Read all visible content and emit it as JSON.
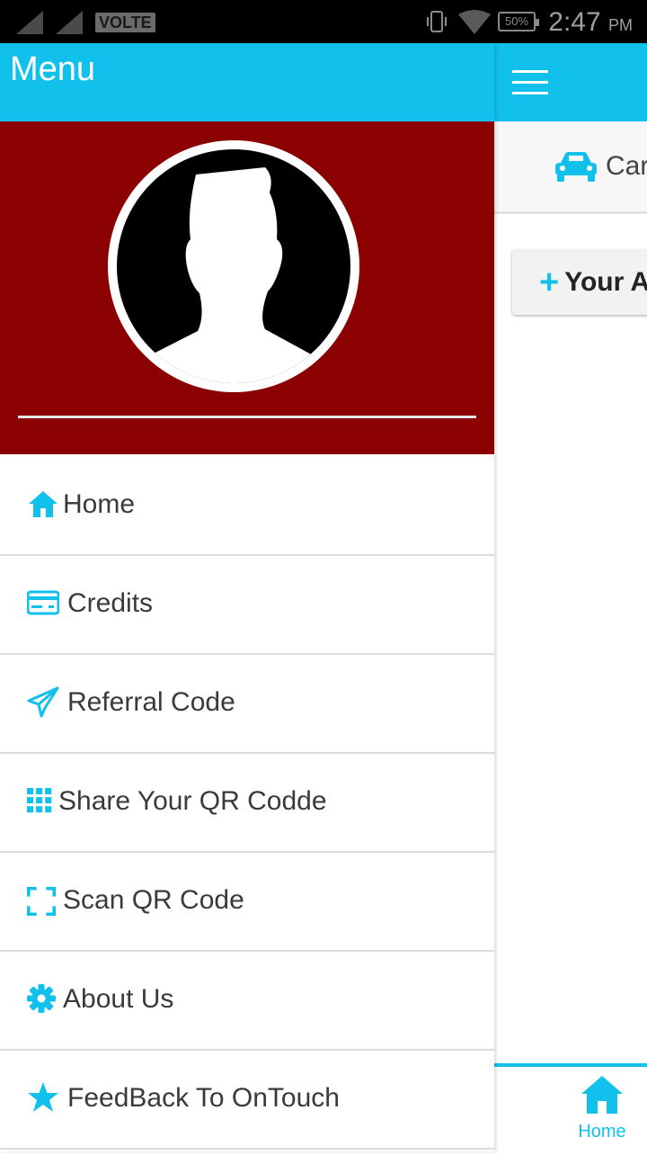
{
  "status_bar": {
    "network": "VOLTE",
    "battery": "50%",
    "time": "2:47",
    "ampm": "PM"
  },
  "drawer": {
    "title": "Menu",
    "menu_items": [
      {
        "label": "Home",
        "icon": "home-icon"
      },
      {
        "label": "Credits",
        "icon": "credit-card-icon"
      },
      {
        "label": "Referral Code",
        "icon": "paper-plane-icon"
      },
      {
        "label": "Share Your QR Codde",
        "icon": "grid-icon"
      },
      {
        "label": "Scan QR Code",
        "icon": "scan-frame-icon"
      },
      {
        "label": "About Us",
        "icon": "gear-icon"
      },
      {
        "label": "FeedBack To OnTouch",
        "icon": "star-icon"
      }
    ]
  },
  "main": {
    "tab_label": "Car",
    "add_button_label": "Your A",
    "bottom_nav_home": "Home"
  },
  "colors": {
    "accent": "#12c0ec",
    "profile_bg": "#8b0000"
  }
}
